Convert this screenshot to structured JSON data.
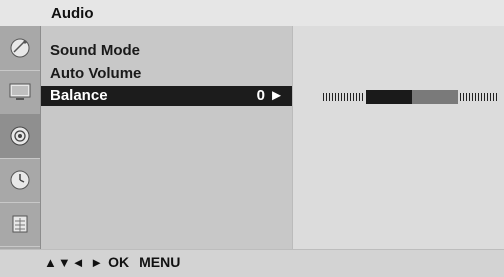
{
  "header": {
    "title": "Audio"
  },
  "sidebar": {
    "icons": [
      {
        "name": "satellite-dish-icon"
      },
      {
        "name": "picture-monitor-icon"
      },
      {
        "name": "speaker-icon",
        "active": true
      },
      {
        "name": "clock-icon"
      },
      {
        "name": "settings-grid-icon"
      }
    ]
  },
  "menu": {
    "items": [
      {
        "label": "Sound Mode"
      },
      {
        "label": "Auto Volume"
      },
      {
        "label": "Balance",
        "value": "0 ►",
        "selected": true
      }
    ]
  },
  "balance": {
    "value": 0,
    "min": -50,
    "max": 50
  },
  "footer": {
    "arrows": "▲▼◄ ►",
    "ok": "OK",
    "menu": "MENU"
  }
}
